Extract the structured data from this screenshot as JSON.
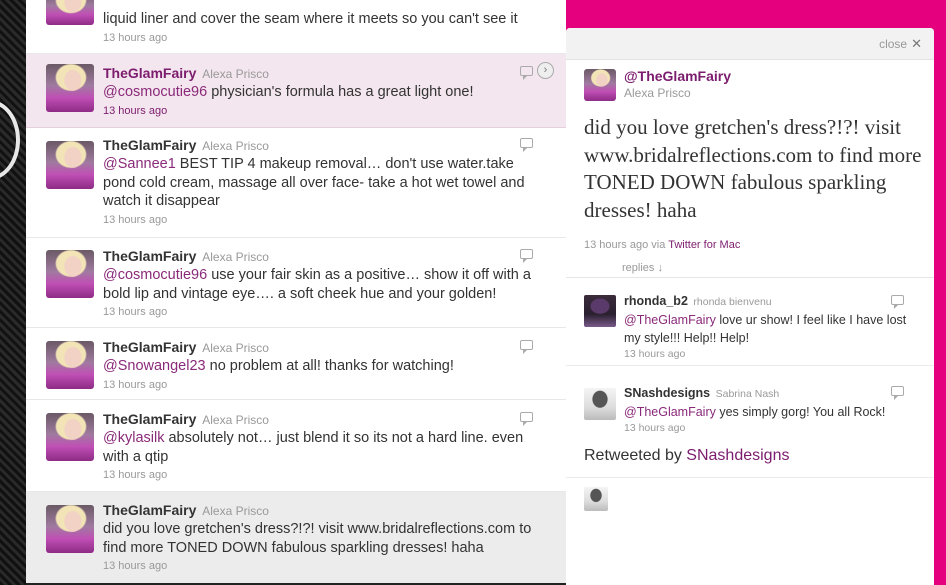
{
  "timeline": {
    "tweets": [
      {
        "screen_name": "",
        "full_name": "",
        "mention": "",
        "text": "liquid liner and cover the seam where it meets so you can't see it",
        "time": "13 hours ago"
      },
      {
        "screen_name": "TheGlamFairy",
        "full_name": "Alexa Prisco",
        "mention": "@cosmocutie96",
        "text": " physician's formula has a great light one!",
        "time": "13 hours ago"
      },
      {
        "screen_name": "TheGlamFairy",
        "full_name": "Alexa Prisco",
        "mention": "@Sannee1",
        "text": " BEST TIP 4 makeup removal… don't use water.take pond cold cream, massage all over face- take a hot wet towel and watch it disappear",
        "time": "13 hours ago"
      },
      {
        "screen_name": "TheGlamFairy",
        "full_name": "Alexa Prisco",
        "mention": "@cosmocutie96",
        "text": " use your fair skin as a positive… show it off with a bold lip and vintage eye…. a soft cheek hue and your golden!",
        "time": "13 hours ago"
      },
      {
        "screen_name": "TheGlamFairy",
        "full_name": "Alexa Prisco",
        "mention": "@Snowangel23",
        "text": " no problem at all! thanks for watching!",
        "time": "13 hours ago"
      },
      {
        "screen_name": "TheGlamFairy",
        "full_name": "Alexa Prisco",
        "mention": "@kylasilk",
        "text": " absolutely not… just blend it so its not a hard line. even with a qtip",
        "time": "13 hours ago"
      },
      {
        "screen_name": "TheGlamFairy",
        "full_name": "Alexa Prisco",
        "mention": "",
        "text": "did you love gretchen's dress?!?! visit www.bridalreflections.com to find more TONED DOWN fabulous sparkling dresses! haha",
        "time": "13 hours ago"
      }
    ]
  },
  "details": {
    "close_label": "close",
    "close_icon": "✕",
    "handle": "@TheGlamFairy",
    "full_name": "Alexa Prisco",
    "text": "did you love gretchen's dress?!?! visit www.bridalreflections.com to find more TONED DOWN fabulous sparkling dresses! haha",
    "time": "13 hours ago",
    "via_prefix": "via",
    "via_app": "Twitter for Mac",
    "replies_label": "replies ↓",
    "replies": [
      {
        "screen_name": "rhonda_b2",
        "full_name": "rhonda bienvenu",
        "mention": "@TheGlamFairy",
        "text": " love ur show! I feel like I have lost my style!!! Help!! Help!",
        "time": "13 hours ago"
      },
      {
        "screen_name": "SNashdesigns",
        "full_name": "Sabrina Nash",
        "mention": "@TheGlamFairy",
        "text": " yes simply gorg! You all Rock!",
        "time": "13 hours ago"
      }
    ],
    "retweeted_prefix": "Retweeted by",
    "retweeted_by": "SNashdesigns"
  },
  "colors": {
    "accent": "#7c1c6e",
    "pink_background": "#e5007e",
    "highlight_row": "#f4e6ee"
  }
}
